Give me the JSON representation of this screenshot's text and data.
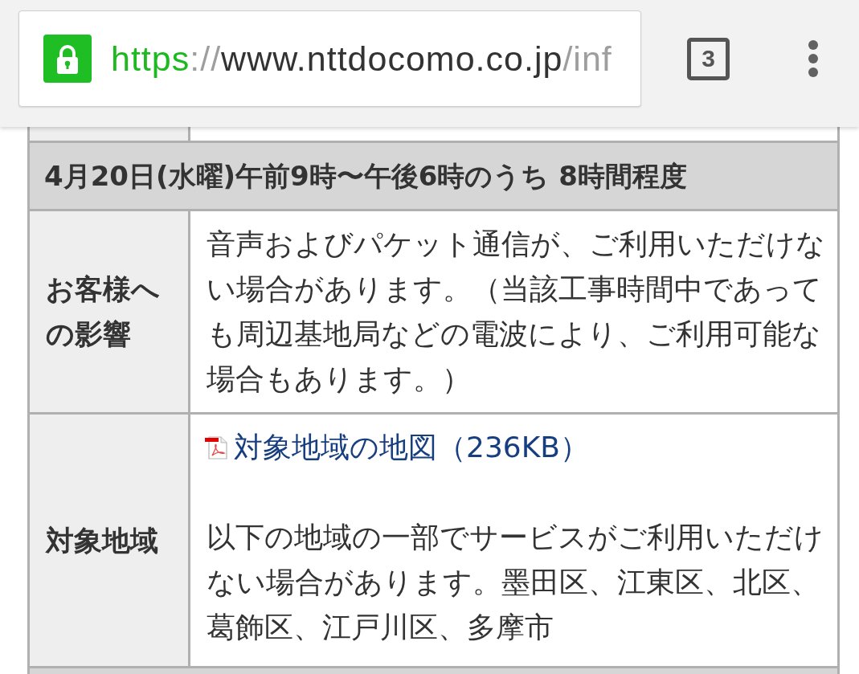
{
  "browser": {
    "url": {
      "scheme": "https",
      "separator": "://",
      "host": "www.nttdocomo.co.jp",
      "path": "/inf"
    },
    "tab_count": "3"
  },
  "table": {
    "header": "4月20日(水曜)午前9時〜午後6時のうち 8時間程度",
    "rows": [
      {
        "label": "お客様への影響",
        "content": [
          {
            "kind": "text",
            "text": "音声およびパケット通信が、ご利用いただけない場合があります。（当該工事時間中であっても周辺基地局などの電波により、ご利用可能な場合もあります。）"
          }
        ]
      },
      {
        "label": "対象地域",
        "content": [
          {
            "kind": "link",
            "text": "対象地域の地図（236KB）"
          },
          {
            "kind": "text",
            "text": "以下の地域の一部でサービスがご利用いただけない場合があります。墨田区、江東区、北区、葛飾区、江戸川区、多摩市"
          }
        ]
      }
    ]
  }
}
